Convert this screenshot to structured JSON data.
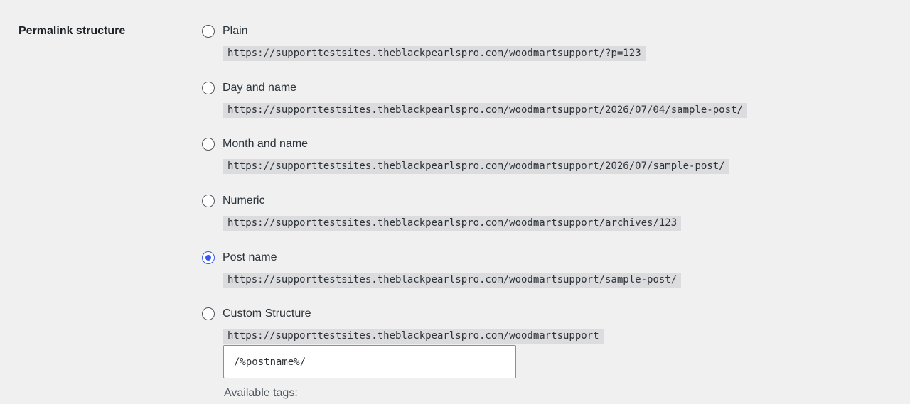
{
  "section": {
    "label": "Permalink structure"
  },
  "options": [
    {
      "label": "Plain",
      "url": "https://supporttestsites.theblackpearlspro.com/woodmartsupport/?p=123",
      "checked": false
    },
    {
      "label": "Day and name",
      "url": "https://supporttestsites.theblackpearlspro.com/woodmartsupport/2026/07/04/sample-post/",
      "checked": false
    },
    {
      "label": "Month and name",
      "url": "https://supporttestsites.theblackpearlspro.com/woodmartsupport/2026/07/sample-post/",
      "checked": false
    },
    {
      "label": "Numeric",
      "url": "https://supporttestsites.theblackpearlspro.com/woodmartsupport/archives/123",
      "checked": false
    },
    {
      "label": "Post name",
      "url": "https://supporttestsites.theblackpearlspro.com/woodmartsupport/sample-post/",
      "checked": true
    },
    {
      "label": "Custom Structure",
      "url": "https://supporttestsites.theblackpearlspro.com/woodmartsupport",
      "checked": false
    }
  ],
  "custom": {
    "value": "/%postname%/"
  },
  "available_tags": {
    "label": "Available tags:"
  },
  "colors": {
    "background": "#f0f0f1",
    "accent": "#3858e9",
    "code_background": "#dcdcde"
  }
}
